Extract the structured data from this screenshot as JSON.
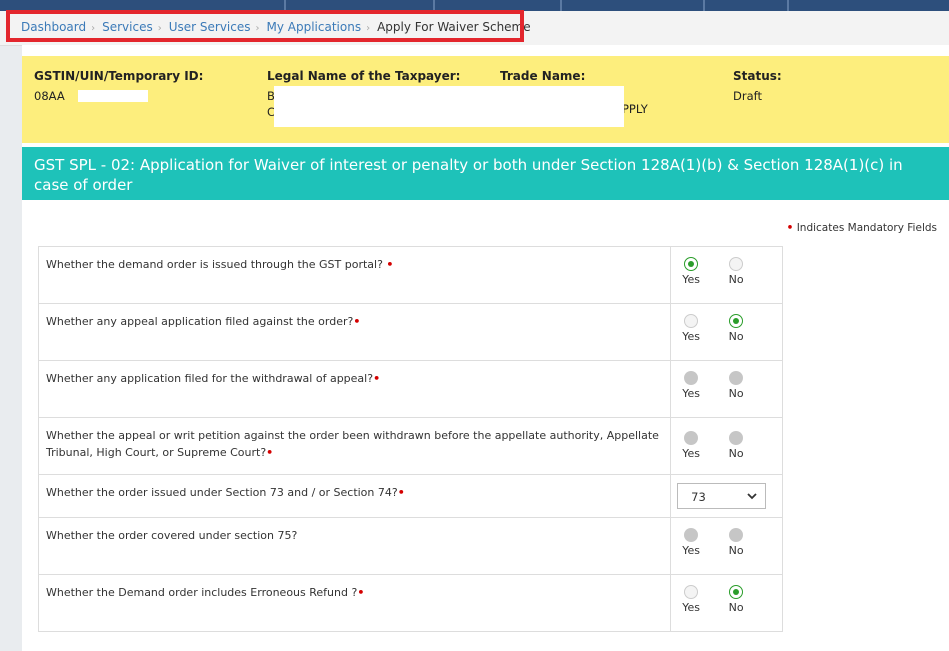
{
  "breadcrumb": {
    "items": [
      "Dashboard",
      "Services",
      "User Services",
      "My Applications"
    ],
    "current": "Apply For Waiver Scheme",
    "separator": "›"
  },
  "taxpayer": {
    "gstin_label": "GSTIN/UIN/Temporary ID:",
    "gstin_value": "08AA",
    "legal_name_label": "Legal Name of the Taxpayer:",
    "legal_name_value_line1": "B",
    "legal_name_value_line2": "C",
    "trade_name_label": "Trade Name:",
    "trade_name_value": "PPLY",
    "status_label": "Status:",
    "status_value": "Draft"
  },
  "form": {
    "title": "GST SPL - 02: Application for Waiver of interest or penalty or both under Section 128A(1)(b) & Section 128A(1)(c) in case of order",
    "mandatory_note": "Indicates Mandatory Fields",
    "mandatory_mark": "•",
    "yes_label": "Yes",
    "no_label": "No",
    "questions": [
      {
        "text": "Whether the demand order is issued through the GST portal?",
        "selected": "yes",
        "state": "active"
      },
      {
        "text": "Whether any appeal application filed against the order?",
        "selected": "no",
        "state": "active"
      },
      {
        "text": "Whether any application filed for the withdrawal of appeal?",
        "selected": "none",
        "state": "disabled"
      },
      {
        "text": "Whether the appeal or writ petition against the order been withdrawn before the appellate authority, Appellate Tribunal, High Court, or Supreme Court?",
        "selected": "none",
        "state": "disabled"
      },
      {
        "text": "Whether the order issued under Section 73 and / or Section 74?",
        "type": "select",
        "value": "73"
      },
      {
        "text": "Whether the order covered under section 75?",
        "selected": "none",
        "state": "disabled",
        "mandatory": false
      },
      {
        "text": "Whether the Demand order includes Erroneous Refund ?",
        "selected": "no",
        "state": "active"
      }
    ]
  },
  "colors": {
    "accent_red": "#e3262d",
    "info_yellow": "#fdee7d",
    "title_teal": "#1ec2b9",
    "radio_green": "#2a9d2a",
    "link_blue": "#3b7ab8"
  }
}
